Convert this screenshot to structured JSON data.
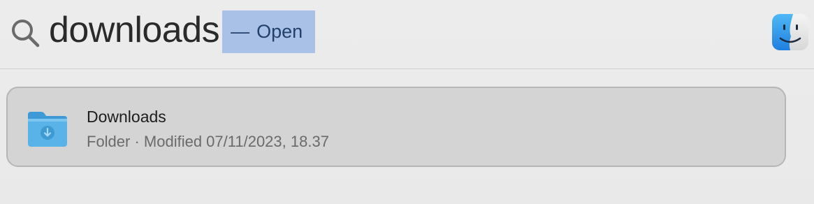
{
  "search": {
    "query": "downloads",
    "completion_dash": "—",
    "completion_label": "Open"
  },
  "icons": {
    "search": "magnifying-glass",
    "app": "finder-face",
    "result": "downloads-folder"
  },
  "colors": {
    "completion_highlight": "#a9c1e6",
    "selected_row": "#d4d4d4",
    "folder_blue": "#5ab3e8"
  },
  "results": [
    {
      "title": "Downloads",
      "subtitle": "Folder · Modified 07/11/2023, 18.37"
    }
  ]
}
